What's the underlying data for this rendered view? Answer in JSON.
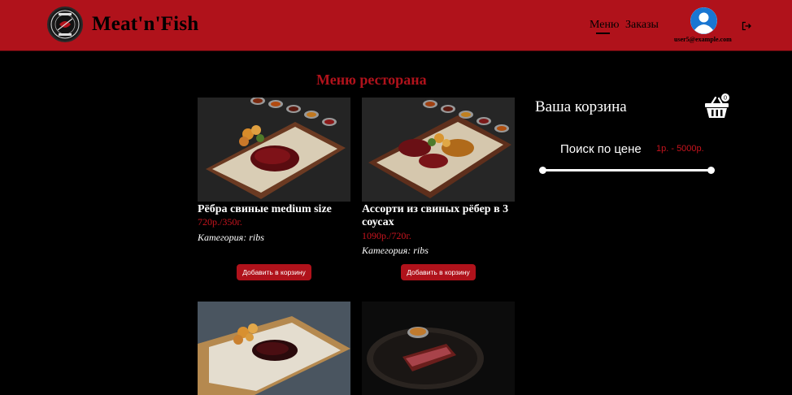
{
  "header": {
    "brand": "Meat'n'Fish",
    "nav": {
      "menu": "Меню",
      "orders": "Заказы"
    },
    "user_email": "user5@example.com"
  },
  "main": {
    "title": "Меню ресторана",
    "products": [
      {
        "name": "Рёбра свиные medium size",
        "price": "720р./350г.",
        "category": "Категория: ribs",
        "button": "Добавить в корзину"
      },
      {
        "name": "Ассорти из свиных рёбер в 3 соусах",
        "price": "1090р./720г.",
        "category": "Категория: ribs",
        "button": "Добавить в корзину"
      },
      {
        "name": "",
        "price": "",
        "category": "",
        "button": ""
      },
      {
        "name": "",
        "price": "",
        "category": "",
        "button": ""
      }
    ]
  },
  "cart": {
    "title": "Ваша корзина",
    "count": "0",
    "search_label": "Поиск по цене",
    "range": "1р. - 5000р.",
    "slider_min": 1,
    "slider_max": 5000
  },
  "colors": {
    "brand_red": "#b0121b",
    "price_red": "#c8141e",
    "background": "#000000"
  },
  "icons": [
    "logo-emblem-icon",
    "user-avatar-icon",
    "logout-icon",
    "shopping-basket-icon"
  ]
}
